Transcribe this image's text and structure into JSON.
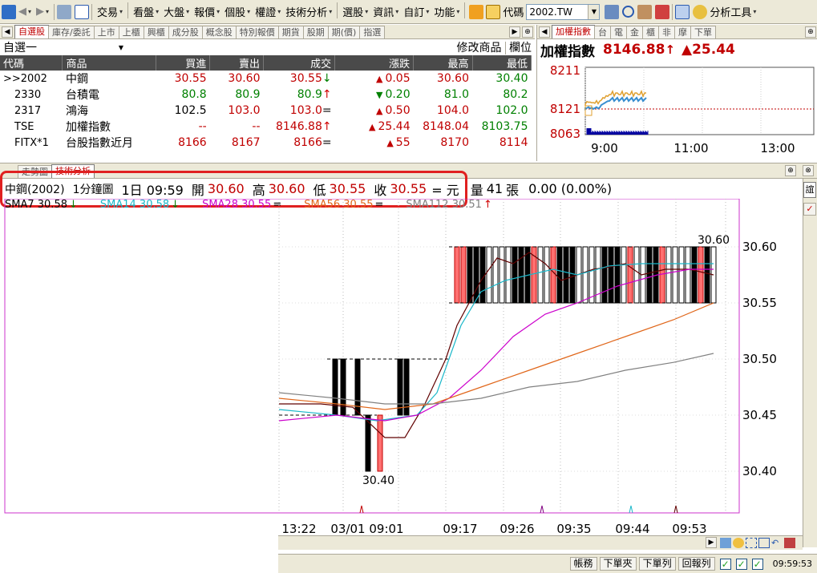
{
  "toolbar": {
    "menus": [
      "交易",
      "看盤",
      "大盤",
      "報價",
      "個股",
      "權證",
      "技術分析",
      "選股",
      "資訊",
      "自訂",
      "功能"
    ],
    "code_label": "代碼",
    "code_value": "2002.TW",
    "analysis_tools": "分析工具"
  },
  "quote_panel": {
    "tabs": [
      "自選股",
      "庫存/委託",
      "上市",
      "上櫃",
      "興櫃",
      "成分股",
      "概念股",
      "特別報價",
      "期貨",
      "股期",
      "期(價)",
      "指選"
    ],
    "group": "自選一",
    "edit_button": "修改商品",
    "columns_button": "欄位",
    "headers": [
      "代碼",
      "商品",
      "買進",
      "賣出",
      "成交",
      "漲跌",
      "最高",
      "最低"
    ],
    "rows": [
      {
        "code": ">>2002",
        "name": "中鋼",
        "bid": "30.55",
        "ask": "30.60",
        "last": "30.55",
        "last_mark": "↓",
        "chg_dir": "▲",
        "chg": "0.05",
        "high": "30.60",
        "low": "30.40"
      },
      {
        "code": "2330",
        "name": "台積電",
        "bid": "80.8",
        "ask": "80.9",
        "last": "80.9",
        "last_mark": "↑",
        "chg_dir": "▼",
        "chg": "0.20",
        "high": "81.0",
        "low": "80.2"
      },
      {
        "code": "2317",
        "name": "鴻海",
        "bid": "102.5",
        "ask": "103.0",
        "last": "103.0",
        "last_mark": "=",
        "chg_dir": "▲",
        "chg": "0.50",
        "high": "104.0",
        "low": "102.0"
      },
      {
        "code": "TSE",
        "name": "加權指數",
        "bid": "--",
        "ask": "--",
        "last": "8146.88",
        "last_mark": "↑",
        "chg_dir": "▲",
        "chg": "25.44",
        "high": "8148.04",
        "low": "8103.75"
      },
      {
        "code": "FITX*1",
        "name": "台股指數近月",
        "bid": "8166",
        "ask": "8167",
        "last": "8166",
        "last_mark": "=",
        "chg_dir": "▲",
        "chg": "55",
        "high": "8170",
        "low": "8114"
      }
    ]
  },
  "index_panel": {
    "tabs": [
      "加權指數",
      "台",
      "電",
      "金",
      "櫃",
      "非",
      "摩",
      "下單"
    ],
    "title": "加權指數",
    "value": "8146.88",
    "change": "▲25.44",
    "y_labels": [
      "8211",
      "8121",
      "8063"
    ],
    "x_labels": [
      "9:00",
      "11:00",
      "13:00"
    ]
  },
  "chart_panel": {
    "tabs": [
      "走勢圖",
      "技術分析"
    ],
    "info": {
      "stock": "中鋼(2002)",
      "period": "1分鐘圖",
      "date": "1日 09:59",
      "open_label": "開",
      "open": "30.60",
      "high_label": "高",
      "high": "30.60",
      "low_label": "低",
      "low": "30.55",
      "close_label": "收",
      "close": "30.55",
      "unit": "= 元",
      "vol_label": "量",
      "vol": "41",
      "vol_unit": "張",
      "change": "0.00 (0.00%)"
    },
    "ma_labels": [
      {
        "text": "SMA7 30.58",
        "mark": "↓",
        "color": "#000000"
      },
      {
        "text": "SMA14 30.58",
        "mark": "↓",
        "color": "#19b7c9"
      },
      {
        "text": "SMA28 30.55",
        "mark": "=",
        "color": "#cc00cc"
      },
      {
        "text": "SMA56 30.55",
        "mark": "=",
        "color": "#e0661a"
      },
      {
        "text": "SMA112 30.51",
        "mark": "↑",
        "color": "#808080"
      }
    ],
    "y_labels": [
      "30.60",
      "30.55",
      "30.50",
      "30.45",
      "30.40"
    ],
    "x_labels": [
      "13:22",
      "03/01 09:01",
      "09:17",
      "09:26",
      "09:35",
      "09:44",
      "09:53"
    ],
    "max_label": "30.60",
    "min_label": "30.40",
    "side_tab": "誼"
  },
  "status_bar": {
    "buttons": [
      "帳務",
      "下單夾",
      "下單列",
      "回報列"
    ],
    "time": "09:59:53"
  }
}
